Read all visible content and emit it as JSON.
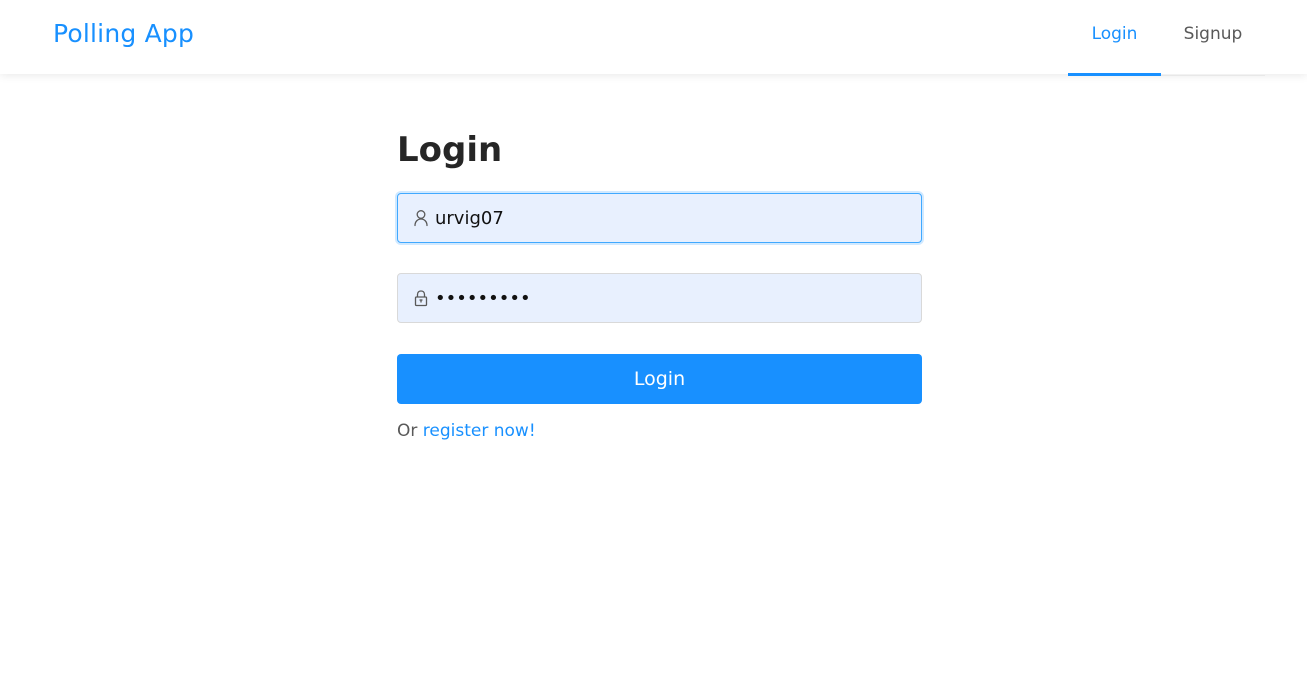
{
  "app": {
    "brand": "Polling App"
  },
  "nav": {
    "items": [
      {
        "label": "Login",
        "active": true
      },
      {
        "label": "Signup",
        "active": false
      }
    ]
  },
  "login_form": {
    "title": "Login",
    "username": {
      "value": "urvig07",
      "icon": "user-icon"
    },
    "password": {
      "value": "•••••••••",
      "icon": "lock-icon"
    },
    "submit_label": "Login",
    "register_prefix": "Or",
    "register_link": "register now!"
  },
  "colors": {
    "primary": "#1890ff",
    "input_background": "#e8f0fe",
    "text_dark": "#262626",
    "text_muted": "#595959"
  }
}
